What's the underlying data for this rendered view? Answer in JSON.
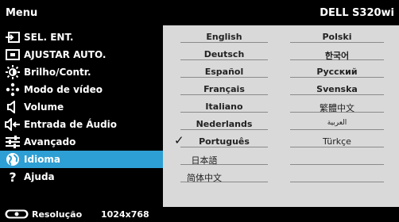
{
  "header": {
    "menu_label": "Menu",
    "model": "DELL S320wi"
  },
  "menu": {
    "items": [
      {
        "label": "SEL. ENT.",
        "icon": "input-source-icon"
      },
      {
        "label": "AJUSTAR AUTO.",
        "icon": "auto-adjust-icon"
      },
      {
        "label": "Brilho/Contr.",
        "icon": "brightness-icon"
      },
      {
        "label": "Modo de vídeo",
        "icon": "video-mode-icon"
      },
      {
        "label": "Volume",
        "icon": "volume-icon"
      },
      {
        "label": "Entrada de Áudio",
        "icon": "audio-input-icon"
      },
      {
        "label": "Avançado",
        "icon": "advanced-icon"
      },
      {
        "label": "Idioma",
        "icon": "globe-icon"
      },
      {
        "label": "Ajuda",
        "icon": "help-icon"
      }
    ],
    "selected_index": 7
  },
  "languages": {
    "col1": [
      "English",
      "Deutsch",
      "Español",
      "Français",
      "Italiano",
      "Nederlands",
      "Português",
      "日本語",
      "简体中文"
    ],
    "col2": [
      "Polski",
      "한국어",
      "Русский",
      "Svenska",
      "繁體中文",
      "العربية",
      "Türkçe"
    ],
    "selected": "Português"
  },
  "footer": {
    "label": "Resolução",
    "value": "1024x768"
  },
  "colors": {
    "selected_bg": "#2e9fd4",
    "panel_bg": "#d9d9d9",
    "background": "#000000"
  }
}
